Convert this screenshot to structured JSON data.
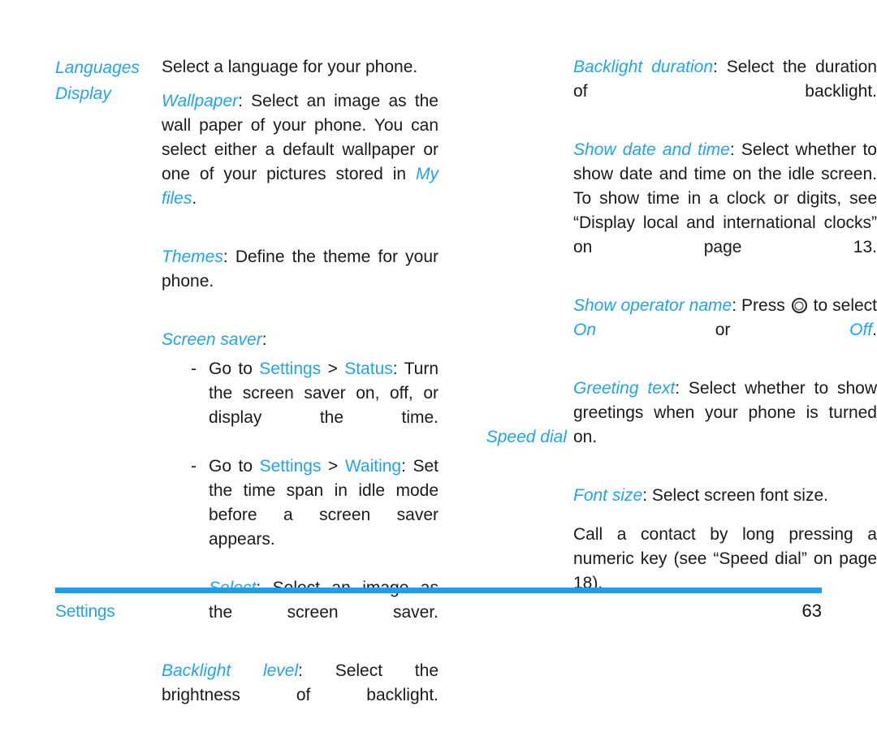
{
  "document": {
    "left_column": {
      "entries": [
        {
          "label": "Languages",
          "paragraphs": [
            {
              "runs": [
                {
                  "t": "Select a language for your phone.",
                  "s": "plain"
                }
              ]
            }
          ]
        },
        {
          "label": "Display",
          "paragraphs": [
            {
              "runs": [
                {
                  "t": "Wallpaper",
                  "s": "kw"
                },
                {
                  "t": ": Select an image as the wall paper of your phone. You can select either a default wallpaper or one of your pictures stored in ",
                  "s": "plain"
                },
                {
                  "t": "My files",
                  "s": "kw"
                },
                {
                  "t": ".",
                  "s": "plain"
                }
              ]
            },
            {
              "runs": [
                {
                  "t": "Themes",
                  "s": "kw"
                },
                {
                  "t": ": Define the theme for your phone.",
                  "s": "plain"
                }
              ]
            },
            {
              "runs": [
                {
                  "t": "Screen saver",
                  "s": "kw"
                },
                {
                  "t": ":",
                  "s": "plain"
                }
              ]
            }
          ],
          "bullets": [
            {
              "marker": "-",
              "runs": [
                {
                  "t": "Go to ",
                  "s": "plain"
                },
                {
                  "t": "Settings",
                  "s": "kw-up"
                },
                {
                  "t": " > ",
                  "s": "plain"
                },
                {
                  "t": "Status",
                  "s": "kw-up"
                },
                {
                  "t": ": Turn the screen saver on, off, or display the time.",
                  "s": "plain"
                }
              ]
            },
            {
              "marker": "-",
              "runs": [
                {
                  "t": "Go to ",
                  "s": "plain"
                },
                {
                  "t": "Settings",
                  "s": "kw-up"
                },
                {
                  "t": " > ",
                  "s": "plain"
                },
                {
                  "t": "Waiting",
                  "s": "kw-up"
                },
                {
                  "t": ": Set the time span in idle mode before a screen saver appears.",
                  "s": "plain"
                }
              ]
            },
            {
              "marker": "-",
              "runs": [
                {
                  "t": "Select",
                  "s": "kw"
                },
                {
                  "t": ": Select an image as the screen saver.",
                  "s": "plain"
                }
              ]
            }
          ],
          "trailing_paragraphs": [
            {
              "runs": [
                {
                  "t": "Backlight level",
                  "s": "kw"
                },
                {
                  "t": ": Select the brightness of backlight.",
                  "s": "plain"
                }
              ]
            }
          ]
        }
      ]
    },
    "right_column": {
      "top_paragraphs": [
        {
          "runs": [
            {
              "t": "Backlight duration",
              "s": "kw"
            },
            {
              "t": ": Select the duration of backlight.",
              "s": "plain"
            }
          ]
        },
        {
          "runs": [
            {
              "t": "Show date and time",
              "s": "kw"
            },
            {
              "t": ": Select whether to show date and time on the idle screen. To show time in a clock or digits, see “Display local and international clocks” on page 13.",
              "s": "plain"
            }
          ]
        },
        {
          "runs": [
            {
              "t": "Show operator name",
              "s": "kw"
            },
            {
              "t": ": Press ",
              "s": "plain"
            },
            {
              "t": "",
              "s": "navkey-icon"
            },
            {
              "t": " to select ",
              "s": "plain"
            },
            {
              "t": "On",
              "s": "kw"
            },
            {
              "t": " or ",
              "s": "plain"
            },
            {
              "t": "Off",
              "s": "kw"
            },
            {
              "t": ".",
              "s": "plain"
            }
          ]
        },
        {
          "runs": [
            {
              "t": "Greeting text",
              "s": "kw"
            },
            {
              "t": ": Select whether to show greetings when your phone is turned on.",
              "s": "plain"
            }
          ]
        },
        {
          "runs": [
            {
              "t": "Font size",
              "s": "kw"
            },
            {
              "t": ": Select screen font size.",
              "s": "plain"
            }
          ]
        }
      ],
      "entries": [
        {
          "label": "Speed dial",
          "paragraphs": [
            {
              "runs": [
                {
                  "t": "Call a contact by long pressing a numeric key (see “Speed dial” on page 18).",
                  "s": "plain"
                }
              ]
            }
          ]
        }
      ]
    }
  },
  "footer": {
    "section_label": "Settings",
    "page_number": "63",
    "rule_color": "#1CA0EE"
  },
  "colors": {
    "accent_blue": "#21A3EF",
    "body_text": "#1a1a1a"
  },
  "icons": {
    "navkey": "navigation-center-key-icon"
  }
}
